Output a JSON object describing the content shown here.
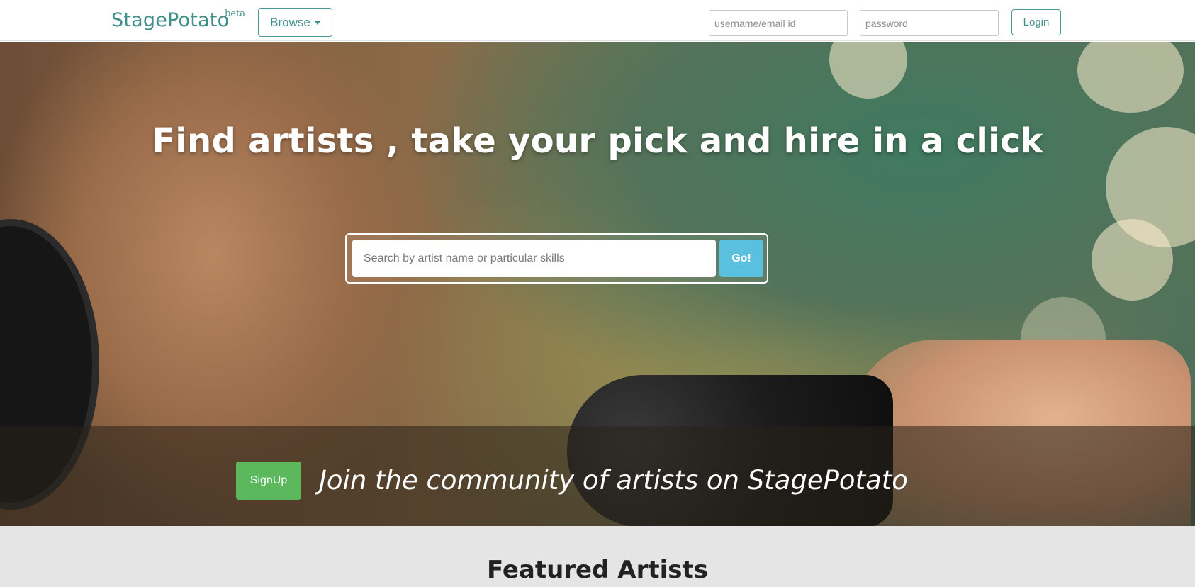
{
  "navbar": {
    "brand": "StagePotato",
    "badge": "beta",
    "browse_label": "Browse",
    "username_placeholder": "username/email id",
    "password_placeholder": "password",
    "login_label": "Login"
  },
  "hero": {
    "headline": "Find artists , take your pick and hire in a click",
    "search_placeholder": "Search by artist name or particular skills",
    "go_label": "Go!",
    "signup_label": "SignUp",
    "join_text": "Join the community of artists on StagePotato"
  },
  "featured": {
    "title": "Featured Artists"
  },
  "colors": {
    "brand_teal": "#3f8f8a",
    "go_blue": "#5bc0de",
    "signup_green": "#5cb85c",
    "featured_bg": "#e5e5e5"
  },
  "icons": {
    "browse_caret": "chevron-down-icon"
  }
}
